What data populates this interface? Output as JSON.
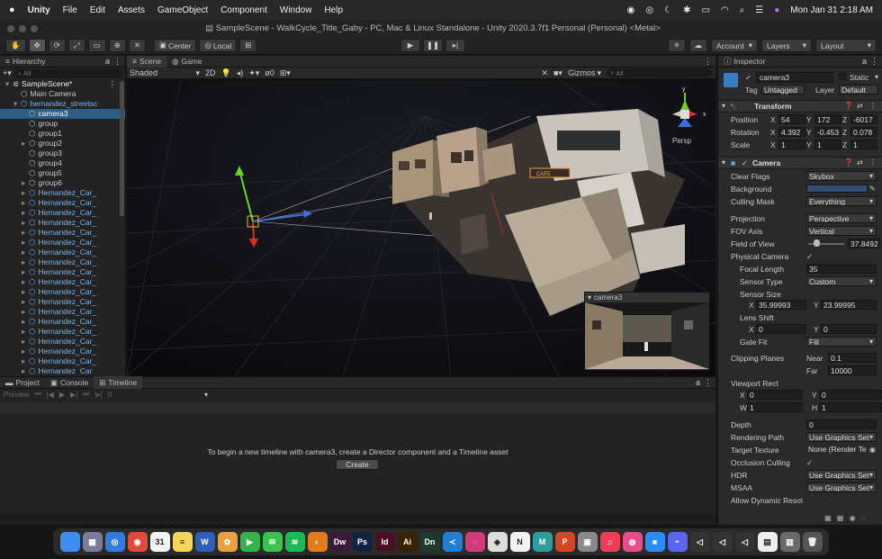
{
  "menubar": {
    "apple": "",
    "app": "Unity",
    "items": [
      "File",
      "Edit",
      "Assets",
      "GameObject",
      "Component",
      "Window",
      "Help"
    ],
    "clock": "Mon Jan 31  2:18 AM"
  },
  "titlebar": {
    "title": "SampleScene - WalkCycle_Title_Gaby - PC, Mac & Linux Standalone - Unity 2020.3.7f1 Personal (Personal) <Metal>"
  },
  "toolbar": {
    "center": "Center",
    "local": "Local",
    "account": "Account",
    "layers": "Layers",
    "layout": "Layout"
  },
  "hierarchy": {
    "tab": "Hierarchy",
    "search_placeholder": "All",
    "items": [
      {
        "label": "SampleScene*",
        "indent": 0,
        "type": "scene"
      },
      {
        "label": "Main Camera",
        "indent": 1,
        "type": "go"
      },
      {
        "label": "hernandez_streetsc",
        "indent": 1,
        "type": "prefab"
      },
      {
        "label": "camera3",
        "indent": 2,
        "type": "go",
        "selected": true
      },
      {
        "label": "group",
        "indent": 2,
        "type": "go"
      },
      {
        "label": "group1",
        "indent": 2,
        "type": "go"
      },
      {
        "label": "group2",
        "indent": 2,
        "type": "go"
      },
      {
        "label": "group3",
        "indent": 2,
        "type": "go"
      },
      {
        "label": "group4",
        "indent": 2,
        "type": "go"
      },
      {
        "label": "group5",
        "indent": 2,
        "type": "go"
      },
      {
        "label": "group6",
        "indent": 2,
        "type": "go"
      },
      {
        "label": "Hernandez_Car_",
        "indent": 2,
        "type": "prefab"
      },
      {
        "label": "Hernandez_Car_",
        "indent": 2,
        "type": "prefab"
      },
      {
        "label": "Hernandez_Car_",
        "indent": 2,
        "type": "prefab"
      },
      {
        "label": "Hernandez_Car_",
        "indent": 2,
        "type": "prefab"
      },
      {
        "label": "Hernandez_Car_",
        "indent": 2,
        "type": "prefab"
      },
      {
        "label": "Hernandez_Car_",
        "indent": 2,
        "type": "prefab"
      },
      {
        "label": "Hernandez_Car_",
        "indent": 2,
        "type": "prefab"
      },
      {
        "label": "Hernandez_Car_",
        "indent": 2,
        "type": "prefab"
      },
      {
        "label": "Hernandez_Car_",
        "indent": 2,
        "type": "prefab"
      },
      {
        "label": "Hernandez_Car_",
        "indent": 2,
        "type": "prefab"
      },
      {
        "label": "Hernandez_Car_",
        "indent": 2,
        "type": "prefab"
      },
      {
        "label": "Hernandez_Car_",
        "indent": 2,
        "type": "prefab"
      },
      {
        "label": "Hernandez_Car_",
        "indent": 2,
        "type": "prefab"
      },
      {
        "label": "Hernandez_Car_",
        "indent": 2,
        "type": "prefab"
      },
      {
        "label": "Hernandez_Car_",
        "indent": 2,
        "type": "prefab"
      },
      {
        "label": "Hernandez_Car_",
        "indent": 2,
        "type": "prefab"
      },
      {
        "label": "Hernandez_Car_",
        "indent": 2,
        "type": "prefab"
      },
      {
        "label": "Hernandez_Car_",
        "indent": 2,
        "type": "prefab"
      },
      {
        "label": "Hernandez_Car_",
        "indent": 2,
        "type": "prefab"
      },
      {
        "label": "Hernandez_Car_",
        "indent": 2,
        "type": "prefab"
      }
    ]
  },
  "scene": {
    "tab_scene": "Scene",
    "tab_game": "Game",
    "shading": "Shaded",
    "mode2d": "2D",
    "gizmos": "Gizmos",
    "search_placeholder": "All",
    "persp": "Persp",
    "zero": "0",
    "preview_title": "camera3",
    "sign_text": "CAFE"
  },
  "bottom": {
    "tabs": [
      "Project",
      "Console",
      "Timeline"
    ],
    "preview": "Preview",
    "frame": "0",
    "message": "To begin a new timeline with camera3, create a Director component and a Timeline asset",
    "create": "Create"
  },
  "inspector": {
    "tab": "Inspector",
    "name": "camera3",
    "static": "Static",
    "tag_label": "Tag",
    "tag": "Untagged",
    "layer_label": "Layer",
    "layer": "Default",
    "transform": "Transform",
    "position": {
      "label": "Position",
      "x": "54",
      "y": "172",
      "z": "-6017"
    },
    "rotation": {
      "label": "Rotation",
      "x": "4.392",
      "y": "-0.453",
      "z": "0.078"
    },
    "scale": {
      "label": "Scale",
      "x": "1",
      "y": "1",
      "z": "1"
    },
    "camera": "Camera",
    "props": [
      {
        "label": "Clear Flags",
        "value": "Skybox",
        "kind": "drop"
      },
      {
        "label": "Background",
        "value": "",
        "kind": "color"
      },
      {
        "label": "Culling Mask",
        "value": "Everything",
        "kind": "drop"
      },
      {
        "label": "Projection",
        "value": "Perspective",
        "kind": "drop"
      },
      {
        "label": "FOV Axis",
        "value": "Vertical",
        "kind": "drop"
      },
      {
        "label": "Field of View",
        "value": "37.8492",
        "kind": "slider"
      },
      {
        "label": "Physical Camera",
        "value": "✓",
        "kind": "check"
      },
      {
        "label": "Focal Length",
        "value": "35",
        "kind": "field",
        "sub": true
      },
      {
        "label": "Sensor Type",
        "value": "Custom",
        "kind": "drop",
        "sub": true
      },
      {
        "label": "Sensor Size",
        "value": "",
        "kind": "none",
        "sub": true
      }
    ],
    "sensor": {
      "x": "35.99993",
      "y": "23.99995"
    },
    "lens_shift_label": "Lens Shift",
    "lens": {
      "x": "0",
      "y": "0"
    },
    "gate_fit": {
      "label": "Gate Fit",
      "value": "Fill"
    },
    "clipping": {
      "label": "Clipping Planes",
      "near_label": "Near",
      "near": "0.1",
      "far_label": "Far",
      "far": "10000"
    },
    "viewport": {
      "label": "Viewport Rect",
      "x": "0",
      "y": "0",
      "w": "1",
      "h": "1"
    },
    "props2": [
      {
        "label": "Depth",
        "value": "0",
        "kind": "field"
      },
      {
        "label": "Rendering Path",
        "value": "Use Graphics Set",
        "kind": "drop"
      },
      {
        "label": "Target Texture",
        "value": "None (Render Te",
        "kind": "obj"
      },
      {
        "label": "Occlusion Culling",
        "value": "✓",
        "kind": "check"
      },
      {
        "label": "HDR",
        "value": "Use Graphics Set",
        "kind": "drop"
      },
      {
        "label": "MSAA",
        "value": "Use Graphics Set",
        "kind": "drop"
      },
      {
        "label": "Allow Dynamic Resol",
        "value": "",
        "kind": "check"
      }
    ]
  },
  "dock": {
    "apps": [
      {
        "name": "finder",
        "bg": "#3b8df0",
        "t": ""
      },
      {
        "name": "launchpad",
        "bg": "#7a7a9a",
        "t": "▦"
      },
      {
        "name": "safari",
        "bg": "#2f7de0",
        "t": "◎"
      },
      {
        "name": "chrome",
        "bg": "#e04a3a",
        "t": "◉"
      },
      {
        "name": "calendar",
        "bg": "#f4f4f4",
        "t": "31"
      },
      {
        "name": "notes",
        "bg": "#f5d55a",
        "t": "≡"
      },
      {
        "name": "word",
        "bg": "#2b5fb8",
        "t": "W"
      },
      {
        "name": "photos",
        "bg": "#e9a040",
        "t": "✿"
      },
      {
        "name": "facetime",
        "bg": "#34b34a",
        "t": "▶"
      },
      {
        "name": "messages",
        "bg": "#3bc24f",
        "t": "✉"
      },
      {
        "name": "spotify",
        "bg": "#1db954",
        "t": "≋"
      },
      {
        "name": "blender",
        "bg": "#e57a1a",
        "t": "◐"
      },
      {
        "name": "dreamweaver",
        "bg": "#3a1a3a",
        "t": "Dw"
      },
      {
        "name": "photoshop",
        "bg": "#0f2440",
        "t": "Ps"
      },
      {
        "name": "indesign",
        "bg": "#4a0f24",
        "t": "Id"
      },
      {
        "name": "illustrator",
        "bg": "#3a2200",
        "t": "Ai"
      },
      {
        "name": "dimension",
        "bg": "#1d3a2a",
        "t": "Dn"
      },
      {
        "name": "vscode",
        "bg": "#1f7fd4",
        "t": "≺"
      },
      {
        "name": "instagram",
        "bg": "#d23a7a",
        "t": "◌"
      },
      {
        "name": "unity",
        "bg": "#dddddd",
        "t": "◈"
      },
      {
        "name": "notion",
        "bg": "#f2f2f2",
        "t": "N"
      },
      {
        "name": "maya",
        "bg": "#2d9d9d",
        "t": "M"
      },
      {
        "name": "powerpoint",
        "bg": "#d24726",
        "t": "P"
      },
      {
        "name": "preview",
        "bg": "#8a8a8a",
        "t": "▣"
      },
      {
        "name": "music",
        "bg": "#f43a55",
        "t": "♫"
      },
      {
        "name": "dribbble",
        "bg": "#ea4c89",
        "t": "◍"
      },
      {
        "name": "zoom",
        "bg": "#2d8cff",
        "t": "■"
      },
      {
        "name": "discord",
        "bg": "#5865f2",
        "t": "◓"
      },
      {
        "name": "unityhub1",
        "bg": "#333",
        "t": "◁"
      },
      {
        "name": "unityhub2",
        "bg": "#333",
        "t": "◁"
      },
      {
        "name": "unityhub3",
        "bg": "#333",
        "t": "◁"
      },
      {
        "name": "document",
        "bg": "#eeeeee",
        "t": "▤"
      },
      {
        "name": "folder",
        "bg": "#6a6a6a",
        "t": "▥"
      },
      {
        "name": "trash",
        "bg": "#555",
        "t": "🗑"
      }
    ]
  }
}
